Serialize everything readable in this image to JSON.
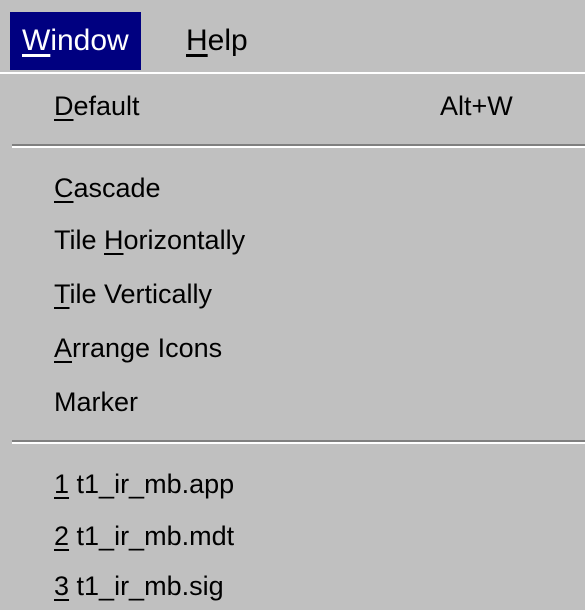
{
  "menubar": {
    "window": {
      "mnemonic": "W",
      "rest": "indow"
    },
    "help": {
      "mnemonic": "H",
      "rest": "elp"
    }
  },
  "window_menu": {
    "default": {
      "mnemonic": "D",
      "rest": "efault",
      "shortcut": "Alt+W"
    },
    "cascade": {
      "mnemonic": "C",
      "rest": "ascade"
    },
    "tile_horizontally": {
      "pre": "Tile ",
      "mnemonic": "H",
      "rest": "orizontally"
    },
    "tile_vertically": {
      "mnemonic": "T",
      "rest": "ile Vertically"
    },
    "arrange_icons": {
      "mnemonic": "A",
      "rest": "rrange Icons"
    },
    "marker": {
      "label": "Marker"
    },
    "windows": [
      {
        "mnemonic": "1",
        "rest": " t1_ir_mb.app"
      },
      {
        "mnemonic": "2",
        "rest": " t1_ir_mb.mdt"
      },
      {
        "mnemonic": "3",
        "rest": " t1_ir_mb.sig"
      }
    ]
  }
}
